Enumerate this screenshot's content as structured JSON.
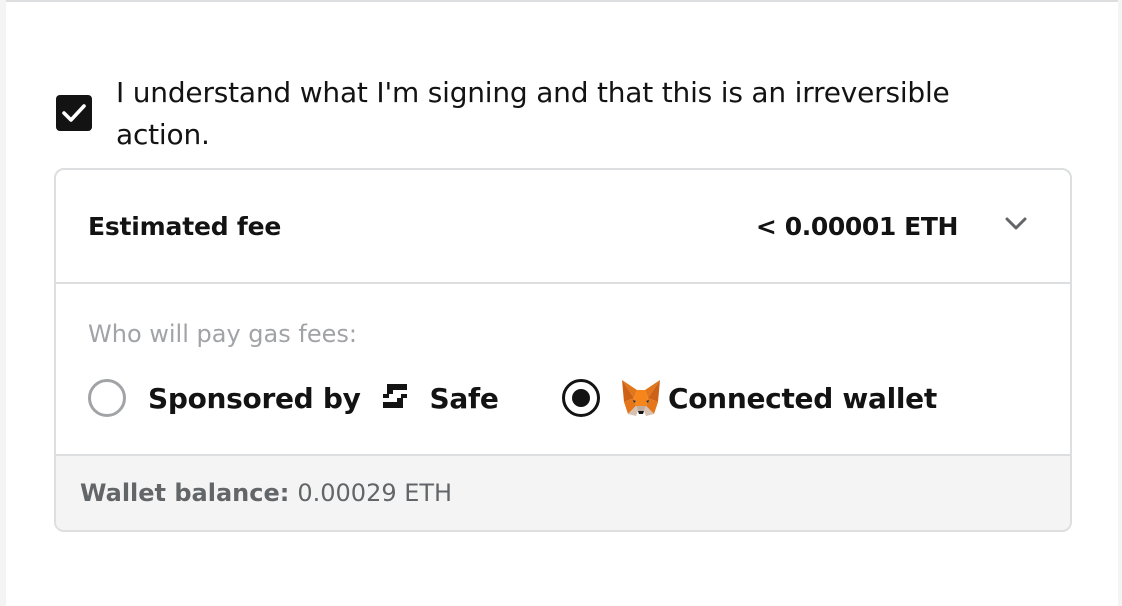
{
  "confirm": {
    "checked": true,
    "text": "I understand what I'm signing and that this is an irreversible action."
  },
  "fee": {
    "label": "Estimated fee",
    "value": "< 0.00001 ETH",
    "toggle_icon": "chevron-down-icon"
  },
  "payer": {
    "question": "Who will pay gas fees:",
    "options": [
      {
        "label_prefix": "Sponsored by",
        "label_suffix": "Safe",
        "icon": "safe-logo-icon",
        "selected": false
      },
      {
        "label": "Connected wallet",
        "icon": "metamask-fox-icon",
        "selected": true
      }
    ]
  },
  "balance": {
    "label": "Wallet balance:",
    "value": "0.00029 ETH"
  },
  "colors": {
    "text": "#121312",
    "muted": "#a1a3a7",
    "border": "#dcdee0",
    "footer_bg": "#f4f4f4"
  }
}
